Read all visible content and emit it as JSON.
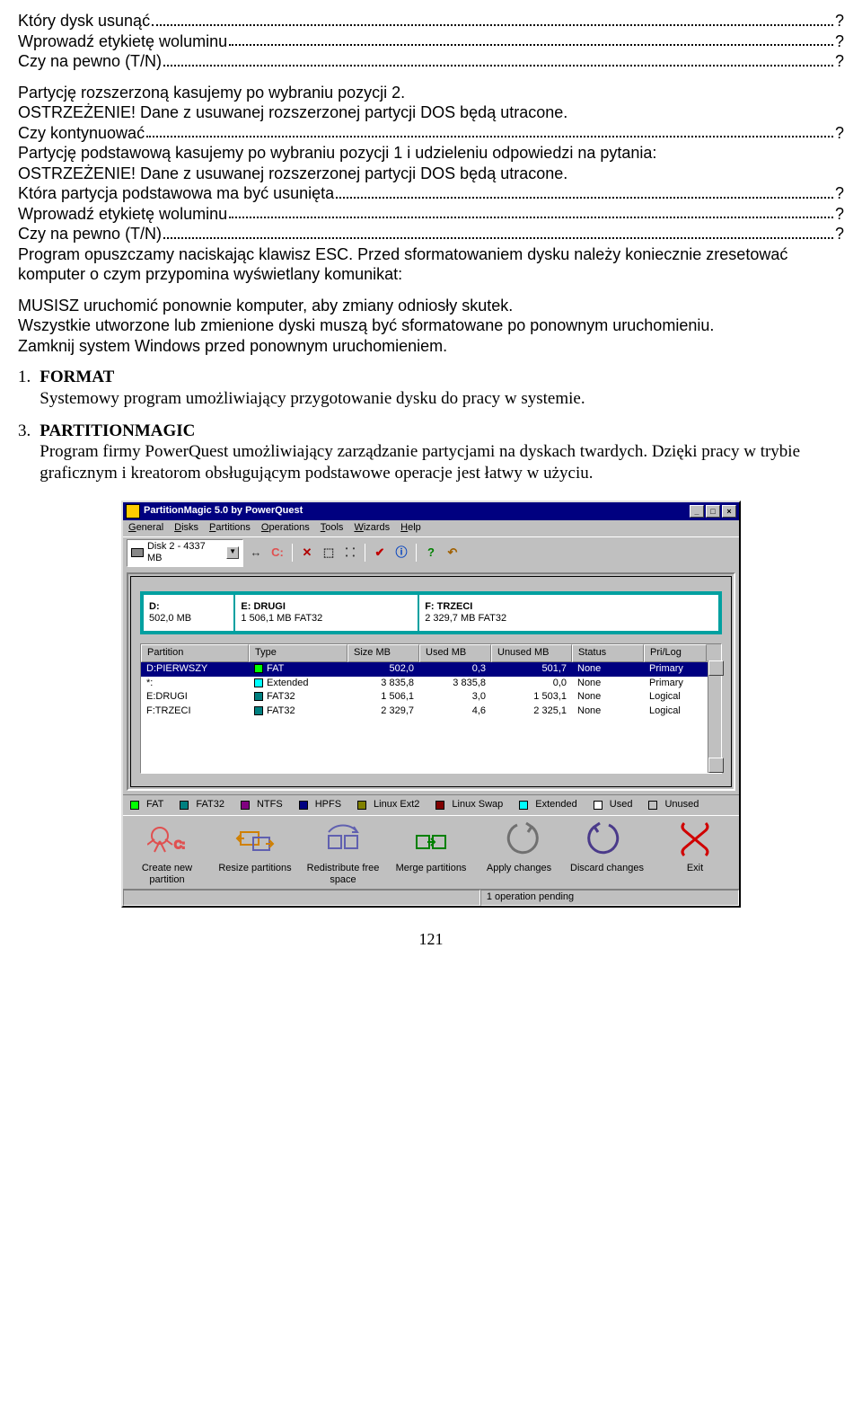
{
  "text": {
    "q1": "Który dysk usunąć",
    "q2": "Wprowadź etykietę woluminu",
    "q3": "Czy na pewno (T/N)",
    "p1": "Partycję rozszerzoną kasujemy po wybraniu pozycji 2.",
    "p2": "OSTRZEŻENIE! Dane z usuwanej rozszerzonej partycji DOS będą utracone.",
    "q4": "Czy kontynuować",
    "p3": "Partycję podstawową kasujemy po wybraniu pozycji 1 i udzieleniu odpowiedzi na pytania:",
    "p4": "OSTRZEŻENIE! Dane z usuwanej rozszerzonej partycji DOS będą utracone.",
    "q5": "Która partycja podstawowa ma być usunięta",
    "q6": "Wprowadź etykietę woluminu",
    "q7": "Czy na pewno (T/N)",
    "p5": "Program opuszczamy naciskając klawisz ESC. Przed sformatowaniem dysku należy koniecznie zresetować komputer o czym przypomina wyświetlany komunikat:",
    "p6": "MUSISZ uruchomić ponownie komputer, aby zmiany odniosły skutek.",
    "p7": "Wszystkie utworzone lub zmienione dyski muszą być sformatowane po ponownym uruchomieniu.",
    "p8": "Zamknij system Windows przed ponownym uruchomieniem.",
    "item1_num": "1.",
    "item1_title": "FORMAT",
    "item1_body": "Systemowy program umożliwiający przygotowanie dysku do pracy w systemie.",
    "item3_num": "3.",
    "item3_title": "PARTITIONMAGIC",
    "item3_body": "Program firmy PowerQuest umożliwiający zarządzanie partycjami na dyskach twardych. Dzięki pracy w trybie graficznym i kreatorom obsługującym podstawowe operacje jest łatwy w użyciu.",
    "qmark": "?",
    "pagenum": "121"
  },
  "pm": {
    "title": "PartitionMagic 5.0 by PowerQuest",
    "win_min": "_",
    "win_max": "□",
    "win_close": "×",
    "menu": [
      "General",
      "Disks",
      "Partitions",
      "Operations",
      "Tools",
      "Wizards",
      "Help"
    ],
    "disk_selector": "Disk 2 - 4337 MB",
    "disk_dd": "▼",
    "toolbar": {
      "arrows": "↔",
      "c": "C:",
      "x": "✕",
      "b1": "⬚",
      "b2": "⸬",
      "check": "✔",
      "info": "ⓘ",
      "q": "?",
      "undo": "↶"
    },
    "segments": [
      {
        "line1": "D:",
        "line2": "502,0 MB",
        "width": "16%"
      },
      {
        "line1": "E: DRUGI",
        "line2": "1 506,1 MB   FAT32",
        "width": "32%"
      },
      {
        "line1": "F: TRZECI",
        "line2": "2 329,7 MB   FAT32",
        "width": "52%"
      }
    ],
    "col": {
      "part": "Partition",
      "type": "Type",
      "size": "Size MB",
      "used": "Used MB",
      "unused": "Unused MB",
      "status": "Status",
      "prilog": "Pri/Log"
    },
    "rows": [
      {
        "p": "D:PIERWSZY",
        "sw": "green",
        "t": "FAT",
        "s": "502,0",
        "u": "0,3",
        "un": "501,7",
        "st": "None",
        "pl": "Primary",
        "sel": true
      },
      {
        "p": "*:",
        "sw": "cyan",
        "t": "Extended",
        "s": "3 835,8",
        "u": "3 835,8",
        "un": "0,0",
        "st": "None",
        "pl": "Primary",
        "sel": false
      },
      {
        "p": "E:DRUGI",
        "sw": "teal",
        "t": "FAT32",
        "s": "1 506,1",
        "u": "3,0",
        "un": "1 503,1",
        "st": "None",
        "pl": "Logical",
        "sel": false
      },
      {
        "p": "F:TRZECI",
        "sw": "teal",
        "t": "FAT32",
        "s": "2 329,7",
        "u": "4,6",
        "un": "2 325,1",
        "st": "None",
        "pl": "Logical",
        "sel": false
      }
    ],
    "legend": [
      {
        "sw": "green",
        "label": "FAT"
      },
      {
        "sw": "teal",
        "label": "FAT32"
      },
      {
        "sw": "purple",
        "label": "NTFS"
      },
      {
        "sw": "navy",
        "label": "HPFS"
      },
      {
        "sw": "olive",
        "label": "Linux Ext2"
      },
      {
        "sw": "maroon",
        "label": "Linux Swap"
      },
      {
        "sw": "cyan",
        "label": "Extended"
      },
      {
        "sw": "white",
        "label": "Used"
      },
      {
        "sw": "gray",
        "label": "Unused"
      }
    ],
    "actions": [
      "Create new partition",
      "Resize partitions",
      "Redistribute free space",
      "Merge partitions",
      "Apply changes",
      "Discard changes",
      "Exit"
    ],
    "status": "1 operation pending"
  }
}
